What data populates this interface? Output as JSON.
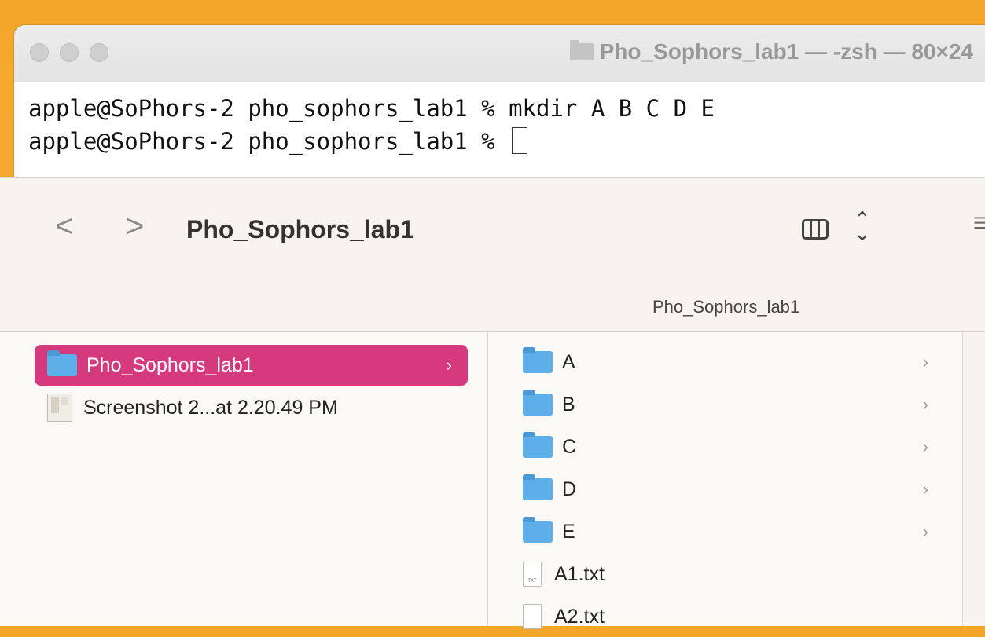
{
  "terminal": {
    "title": "Pho_Sophors_lab1 — -zsh — 80×24",
    "lines": [
      "apple@SoPhors-2 pho_sophors_lab1 % mkdir A B C D E",
      "apple@SoPhors-2 pho_sophors_lab1 % "
    ]
  },
  "finder": {
    "back_label": "<",
    "forward_label": ">",
    "title": "Pho_Sophors_lab1",
    "path_label": "Pho_Sophors_lab1",
    "column1": [
      {
        "label": "Pho_Sophors_lab1",
        "kind": "folder",
        "selected": true
      },
      {
        "label": "Screenshot 2...at 2.20.49 PM",
        "kind": "image",
        "selected": false
      }
    ],
    "column2": [
      {
        "label": "A",
        "kind": "folder"
      },
      {
        "label": "B",
        "kind": "folder"
      },
      {
        "label": "C",
        "kind": "folder"
      },
      {
        "label": "D",
        "kind": "folder"
      },
      {
        "label": "E",
        "kind": "folder"
      },
      {
        "label": "A1.txt",
        "kind": "txt",
        "badge": "TXT"
      },
      {
        "label": "A2.txt",
        "kind": "txt",
        "badge": ""
      }
    ]
  },
  "colors": {
    "selection": "#d63a7e",
    "folder": "#5daee9",
    "wallpaper": "#f4a62a"
  }
}
